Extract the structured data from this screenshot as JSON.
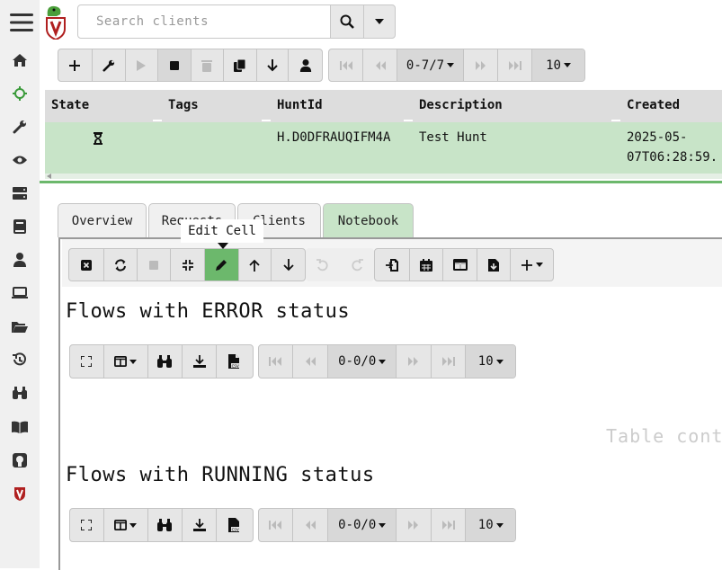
{
  "search": {
    "placeholder": "Search clients"
  },
  "toolbar": {
    "pager": "0-7/7",
    "page_size": "10"
  },
  "table": {
    "headers": [
      "State",
      "Tags",
      "HuntId",
      "Description",
      "Created"
    ],
    "row": {
      "hunt_id": "H.D0DFRAUQIFM4A",
      "description": "Test Hunt",
      "created_line1": "2025-05-",
      "created_line2": "07T06:28:59."
    }
  },
  "tabs": [
    "Overview",
    "Requests",
    "Clients",
    "Notebook"
  ],
  "tooltip": "Edit Cell",
  "notebook": {
    "cell1_title": "Flows with ERROR status",
    "cell2_title": "Flows with RUNNING status",
    "pager": "0-0/0",
    "page_size": "10",
    "placeholder": "Table cont"
  },
  "colors": {
    "accent": "#6cb86c",
    "row_highlight": "#c8e4c8"
  }
}
